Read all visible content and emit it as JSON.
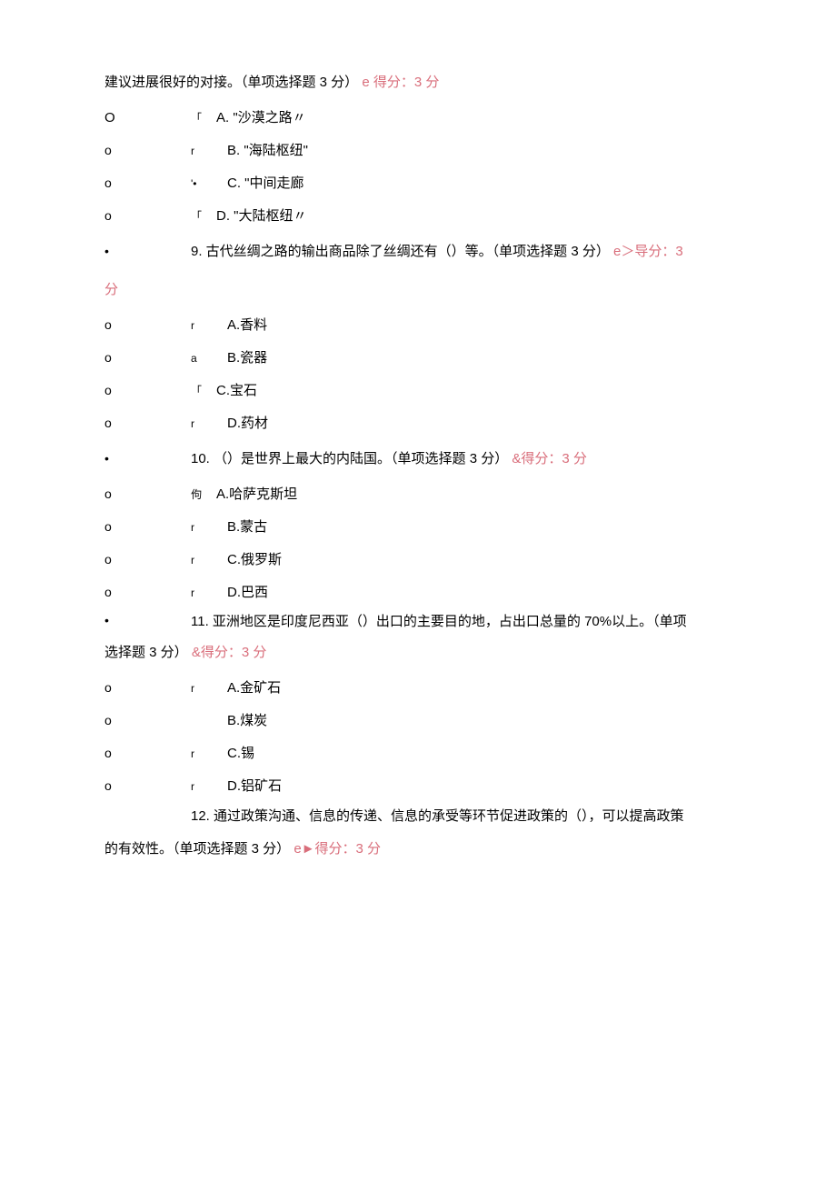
{
  "intro": {
    "line1_part1": "建议进展很好的对接。（单项选择题 3 分）",
    "line1_score_e": "e 得分：3 分"
  },
  "q8_options": {
    "a_mark": "「",
    "a": "A.  \"沙漠之路〃",
    "b_mark": "r",
    "b": "B. \"海陆枢纽\"",
    "c_mark": "'•",
    "c": "C.  \"中间走廊",
    "d_mark": "「",
    "d": "D.  \"大陆枢纽〃"
  },
  "q9": {
    "num": "9.",
    "text": " 古代丝绸之路的输出商品除了丝绸还有（）等。（单项选择题 3 分）",
    "score_e": "e＞导分：3",
    "score_cont": "分",
    "opts": {
      "a_mark": "r",
      "a": "A.香料",
      "b_mark": "a",
      "b": "B.瓷器",
      "c_mark": "「",
      "c": "C.宝石",
      "d_mark": "r",
      "d": "D.药材"
    }
  },
  "q10": {
    "num": "10.",
    "text": " （）是世界上最大的内陆国。（单项选择题 3 分）",
    "score_amp": "&得分：3 分",
    "opts": {
      "a_mark": "佝 ",
      "a": "A.哈萨克斯坦",
      "b_mark": "r",
      "b": "B.蒙古",
      "c_mark": "r",
      "c": "C.俄罗斯",
      "d_mark": "r",
      "d": "D.巴西"
    }
  },
  "q11": {
    "num": "11.",
    "text": " 亚洲地区是印度尼西亚（）出口的主要目的地，占出口总量的 70%以上。（单项",
    "cont": "选择题 3 分）",
    "score_amp": "&得分：3 分",
    "opts": {
      "a_mark": "r",
      "a": "A.金矿石",
      "b_mark": "",
      "b": "B.煤炭",
      "c_mark": "r",
      "c": "C.锡",
      "d_mark": "r",
      "d": "D.铝矿石"
    }
  },
  "q12": {
    "num": "12.",
    "text": " 通过政策沟通、信息的传递、信息的承受等环节促进政策的（），可以提高政策",
    "cont": "的有效性。（单项选择题 3 分）",
    "score_e": "e►得分：3 分"
  }
}
